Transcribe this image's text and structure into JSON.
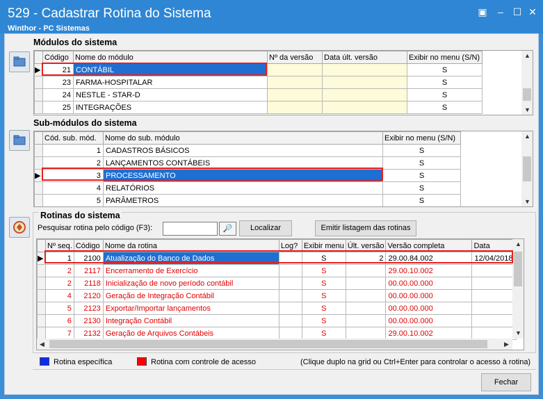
{
  "window": {
    "title": "529 - Cadastrar Rotina do Sistema",
    "subtitle": "Winthor - PC Sistemas"
  },
  "modulos": {
    "title": "Módulos do sistema",
    "columns": [
      "Código",
      "Nome do módulo",
      "Nº da versão",
      "Data últ. versão",
      "Exibir no menu (S/N)"
    ],
    "rows": [
      {
        "codigo": "21",
        "nome": "CONTÁBIL",
        "versao": "",
        "data": "",
        "exibir": "S"
      },
      {
        "codigo": "23",
        "nome": "FARMA-HOSPITALAR",
        "versao": "",
        "data": "",
        "exibir": "S"
      },
      {
        "codigo": "24",
        "nome": "NESTLE - STAR-D",
        "versao": "",
        "data": "",
        "exibir": "S"
      },
      {
        "codigo": "25",
        "nome": "INTEGRAÇÕES",
        "versao": "",
        "data": "",
        "exibir": "S"
      }
    ]
  },
  "submodulos": {
    "title": "Sub-módulos do sistema",
    "columns": [
      "Cód. sub. mód.",
      "Nome do sub. módulo",
      "Exibir no menu (S/N)"
    ],
    "rows": [
      {
        "codigo": "1",
        "nome": "CADASTROS BÁSICOS",
        "exibir": "S"
      },
      {
        "codigo": "2",
        "nome": "LANÇAMENTOS CONTÁBEIS",
        "exibir": "S"
      },
      {
        "codigo": "3",
        "nome": "PROCESSAMENTO",
        "exibir": "S"
      },
      {
        "codigo": "4",
        "nome": "RELATÓRIOS",
        "exibir": "S"
      },
      {
        "codigo": "5",
        "nome": "PARÂMETROS",
        "exibir": "S"
      }
    ]
  },
  "rotinas": {
    "title": "Rotinas do sistema",
    "search_label": "Pesquisar rotina pelo código (F3):",
    "search_value": "",
    "localizar": "Localizar",
    "emitir": "Emitir listagem das rotinas",
    "columns": [
      "Nº seq.",
      "Código",
      "Nome da rotina",
      "Log?",
      "Exibir menu",
      "Últ. versão",
      "Versão completa",
      "Data"
    ],
    "rows": [
      {
        "seq": "1",
        "codigo": "2100",
        "nome": "Atualização do Banco de Dados",
        "log": "",
        "exibir": "S",
        "ult": "2",
        "versao": "29.00.84.002",
        "data": "12/04/2018"
      },
      {
        "seq": "2",
        "codigo": "2117",
        "nome": "Encerramento de Exercício",
        "log": "",
        "exibir": "S",
        "ult": "",
        "versao": "29.00.10.002",
        "data": ""
      },
      {
        "seq": "2",
        "codigo": "2118",
        "nome": "Inicialização de novo período contábil",
        "log": "",
        "exibir": "S",
        "ult": "",
        "versao": "00.00.00.000",
        "data": ""
      },
      {
        "seq": "4",
        "codigo": "2120",
        "nome": "Geração de Integração Contábil",
        "log": "",
        "exibir": "S",
        "ult": "",
        "versao": "00.00.00.000",
        "data": ""
      },
      {
        "seq": "5",
        "codigo": "2123",
        "nome": "Exportar/Importar lançamentos",
        "log": "",
        "exibir": "S",
        "ult": "",
        "versao": "00.00.00.000",
        "data": ""
      },
      {
        "seq": "6",
        "codigo": "2130",
        "nome": "Integração Contábil",
        "log": "",
        "exibir": "S",
        "ult": "",
        "versao": "00.00.00.000",
        "data": ""
      },
      {
        "seq": "7",
        "codigo": "2132",
        "nome": "Geração de Arquivos Contábeis",
        "log": "",
        "exibir": "S",
        "ult": "",
        "versao": "29.00.10.002",
        "data": ""
      }
    ]
  },
  "legend": {
    "blue": "Rotina específica",
    "red": "Rotina com controle de acesso",
    "hint": "(Clique duplo na grid ou Ctrl+Enter para controlar o acesso à rotina)"
  },
  "colors": {
    "blue": "#0a2cf0",
    "red": "#ff0000",
    "selection": "#1f6fd1",
    "highlight_box": "#e8201e"
  },
  "footer": {
    "fechar": "Fechar"
  }
}
